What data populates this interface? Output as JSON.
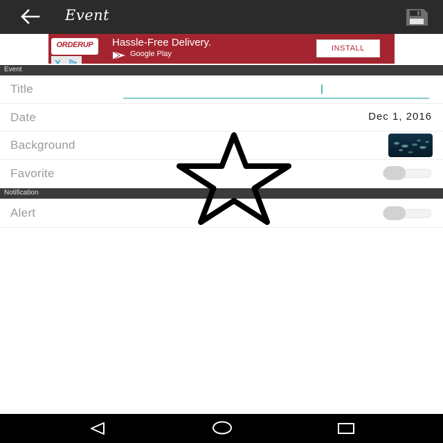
{
  "toolbar": {
    "title": "Event",
    "back_icon": "arrow-left-icon",
    "save_icon": "floppy-disk-icon"
  },
  "ad": {
    "brand": "ORDERUP",
    "headline": "Hassle-Free Delivery.",
    "store": "Google Play",
    "cta": "INSTALL",
    "colors": {
      "background": "#a4252f",
      "cta_text": "#b3202c"
    }
  },
  "sections": {
    "event": "Event",
    "notification": "Notification"
  },
  "fields": {
    "title": {
      "label": "Title",
      "value": ""
    },
    "date": {
      "label": "Date",
      "value": "Dec 1, 2016"
    },
    "background": {
      "label": "Background"
    },
    "favorite": {
      "label": "Favorite",
      "on": false
    },
    "alert": {
      "label": "Alert",
      "on": false
    }
  },
  "overlay": {
    "icon": "star-outline-icon"
  },
  "system_nav": {
    "back_icon": "triangle-back-icon",
    "home_icon": "circle-home-icon",
    "recents_icon": "square-recents-icon"
  },
  "colors": {
    "toolbar": "#2b2b2b",
    "section_header": "#3b3b3b",
    "input_underline": "#85cfc9",
    "label": "#9a9a9a"
  }
}
